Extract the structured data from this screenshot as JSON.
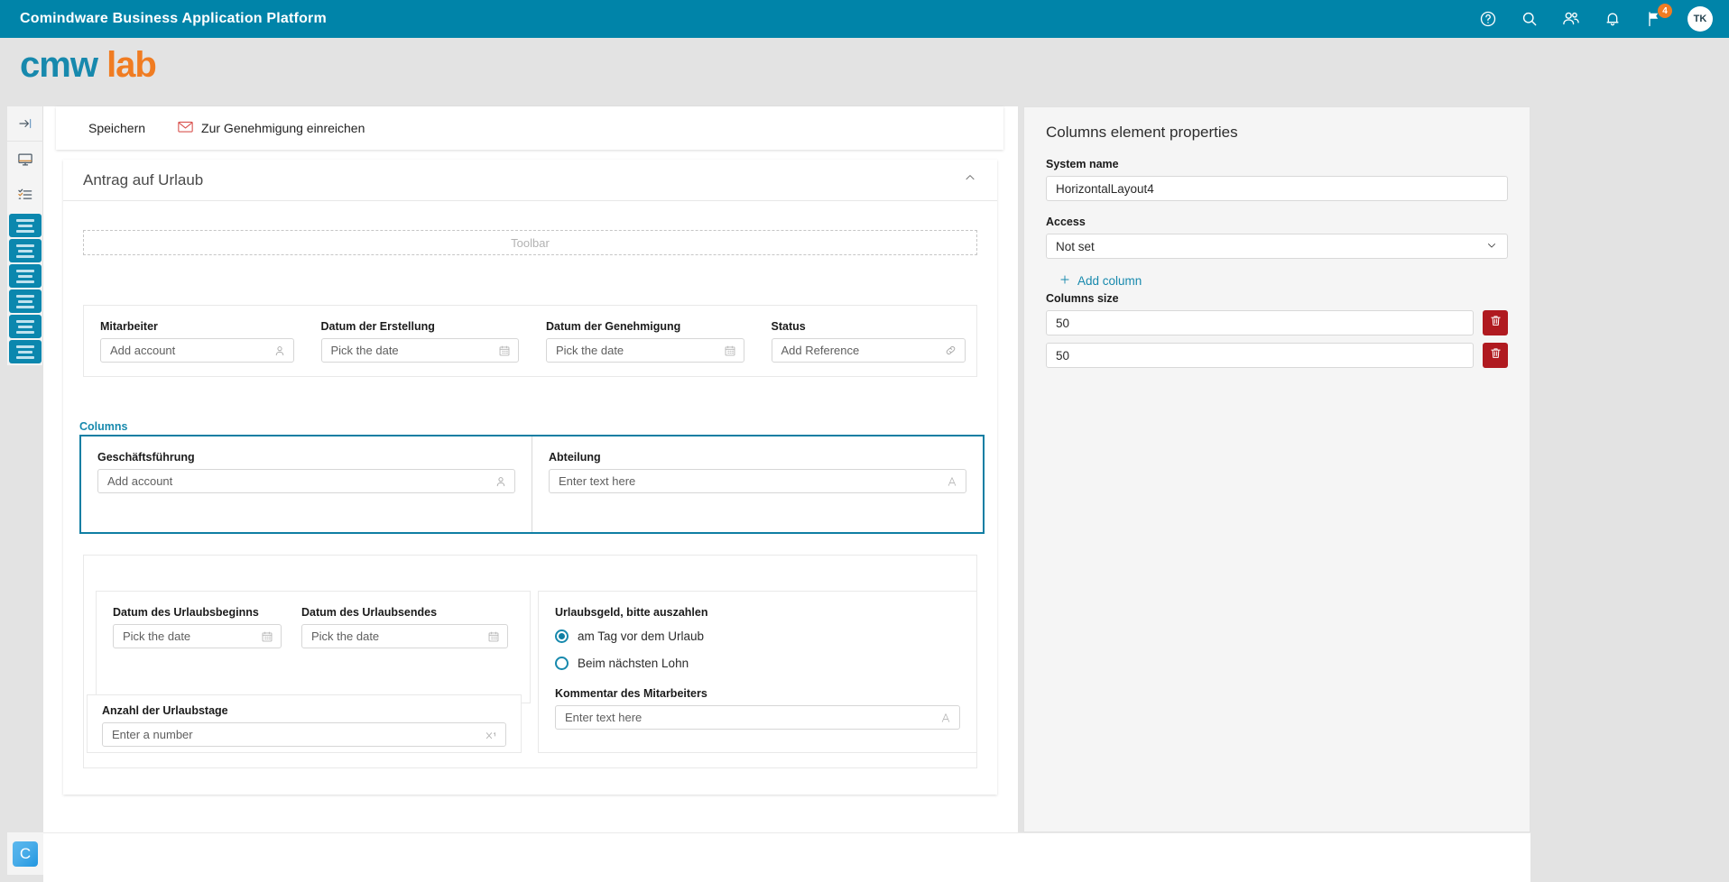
{
  "topbar": {
    "title": "Comindware Business Application Platform",
    "icons": [
      {
        "name": "help-icon",
        "glyph": "?"
      },
      {
        "name": "search-icon",
        "glyph": "search"
      },
      {
        "name": "people-icon",
        "glyph": "people"
      },
      {
        "name": "bell-icon",
        "glyph": "bell"
      },
      {
        "name": "flag-icon",
        "glyph": "flag",
        "badge": "4"
      }
    ],
    "avatar_initials": "TK",
    "brand_color": "#0084a9",
    "badge_color": "#f07c22"
  },
  "logo": {
    "part1": "cmw",
    "part2": "lab",
    "color1": "#1789ad",
    "color2": "#f07c22"
  },
  "rail": {
    "collapse_label": "→|",
    "items": [
      {
        "name": "collapse-panel-icon"
      },
      {
        "name": "monitor-icon"
      },
      {
        "name": "checklist-icon"
      }
    ],
    "block_count": 6,
    "block_color": "#0b87ae",
    "bottom_tile": "C"
  },
  "actionbar": {
    "save_label": "Speichern",
    "submit_label": "Zur Genehmigung einreichen"
  },
  "form": {
    "title": "Antrag auf Urlaub",
    "toolbar_placeholder": "Toolbar",
    "row1": [
      {
        "label": "Mitarbeiter",
        "placeholder": "Add account",
        "suffix": "user-icon"
      },
      {
        "label": "Datum der Erstellung",
        "placeholder": "Pick the date",
        "suffix": "calendar-icon"
      },
      {
        "label": "Datum der Genehmigung",
        "placeholder": "Pick the date",
        "suffix": "calendar-icon"
      },
      {
        "label": "Status",
        "placeholder": "Add Reference",
        "suffix": "link-icon"
      }
    ],
    "columns_label": "Columns",
    "columns": [
      {
        "label": "Geschäftsführung",
        "placeholder": "Add account",
        "suffix": "user-icon"
      },
      {
        "label": "Abteilung",
        "placeholder": "Enter text here",
        "suffix": "text-icon"
      }
    ],
    "dates": [
      {
        "label": "Datum des Urlaubsbeginns",
        "placeholder": "Pick the date",
        "suffix": "calendar-icon"
      },
      {
        "label": "Datum des Urlaubsendes",
        "placeholder": "Pick the date",
        "suffix": "calendar-icon"
      }
    ],
    "days": {
      "label": "Anzahl der Urlaubstage",
      "placeholder": "Enter a number",
      "suffix": "number-icon"
    },
    "radio_group": {
      "label": "Urlaubsgeld, bitte auszahlen",
      "options": [
        {
          "label": "am Tag vor dem Urlaub",
          "selected": true
        },
        {
          "label": "Beim nächsten Lohn",
          "selected": false
        }
      ]
    },
    "comment": {
      "label": "Kommentar des Mitarbeiters",
      "placeholder": "Enter text here",
      "suffix": "text-icon"
    }
  },
  "props": {
    "title": "Columns element properties",
    "system_name_label": "System name",
    "system_name_value": "HorizontalLayout4",
    "access_label": "Access",
    "access_value": "Not set",
    "add_column_label": "Add column",
    "columns_size_label": "Columns size",
    "sizes": [
      "50",
      "50"
    ],
    "accent_color": "#1789ad",
    "delete_color": "#b01a20"
  }
}
